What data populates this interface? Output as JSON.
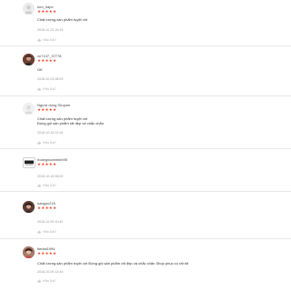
{
  "star_glyph": "★",
  "accent_color": "#ee4d2d",
  "reviews": [
    {
      "username": "tom_hapv",
      "rating": 5,
      "comment_lines": [
        "Chất lượng sản phẩm tuyệt vời"
      ],
      "date": "2018-10-23 15:19",
      "like_label": "Hữu Ích?",
      "avatar": "person-silhouette"
    },
    {
      "username": "vn7137_37778",
      "rating": 5,
      "comment_lines": [
        "OK"
      ],
      "date": "2018-10-23 08:03",
      "like_label": "Hữu Ích?",
      "avatar": "user-photo"
    },
    {
      "username": "Người dùng Shopee",
      "rating": 5,
      "comment_lines": [
        "Chất lượng sản phẩm tuyệt vời",
        "Đóng gói sản phẩm rất đẹp và chắc chắn"
      ],
      "date": "2018-10-18 22:16",
      "like_label": "Hữu Ích?",
      "avatar": "blank"
    },
    {
      "username": "hoangxuanminh95",
      "rating": 5,
      "comment_lines": [],
      "date": "2018-10-15 08:00",
      "like_label": "Hữu Ích?",
      "avatar": "brand-logo"
    },
    {
      "username": "nangoc215",
      "rating": 5,
      "comment_lines": [],
      "date": "2018-10-09 10:42",
      "like_label": "Hữu Ích?",
      "avatar": "user-photo"
    },
    {
      "username": "tienlai1994",
      "rating": 5,
      "comment_lines": [
        "Chất lượng sản phẩm tuyệt vời Đóng gói sản phẩm rất đẹp và chắc chắn Shop phục vụ rất tốt"
      ],
      "date": "2018-10-09 13:44",
      "like_label": "Hữu Ích?",
      "avatar": "user-photo"
    }
  ]
}
